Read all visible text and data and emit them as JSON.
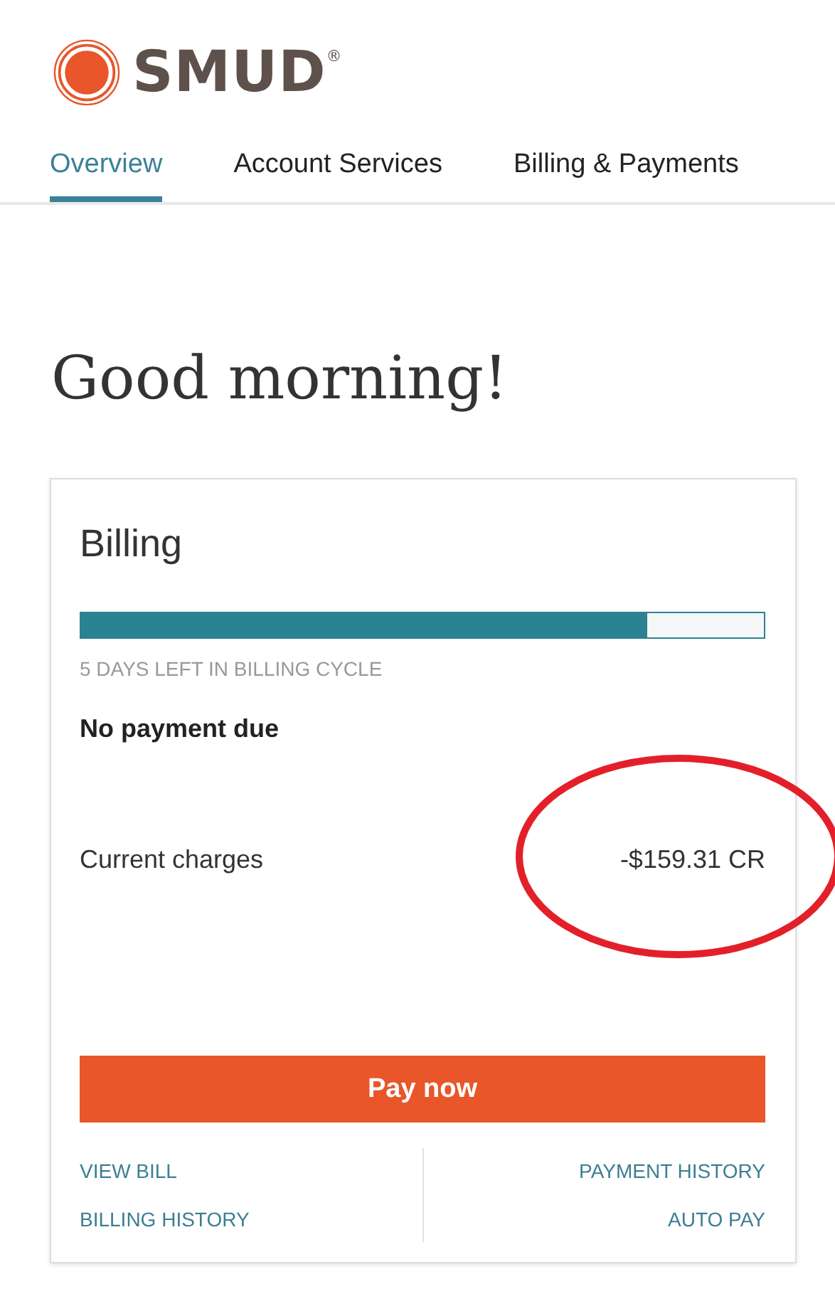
{
  "logo": {
    "name": "SMUD",
    "mark": "®"
  },
  "tabs": [
    {
      "label": "Overview",
      "selected": true
    },
    {
      "label": "Account Services",
      "selected": false
    },
    {
      "label": "Billing & Payments",
      "selected": false
    }
  ],
  "greeting": "Good morning!",
  "billing": {
    "title": "Billing",
    "level": 0.83,
    "cycle_text": "5 DAYS LEFT IN BILLING CYCLE",
    "status": "No payment due",
    "charges_label": "Current charges",
    "charges_value": "-$159.31 CR",
    "circled": true,
    "pay_button": "Pay now",
    "links_left": [
      "VIEW BILL",
      "BILLING HISTORY"
    ],
    "links_right": [
      "PAYMENT HISTORY",
      "AUTO PAY"
    ]
  }
}
